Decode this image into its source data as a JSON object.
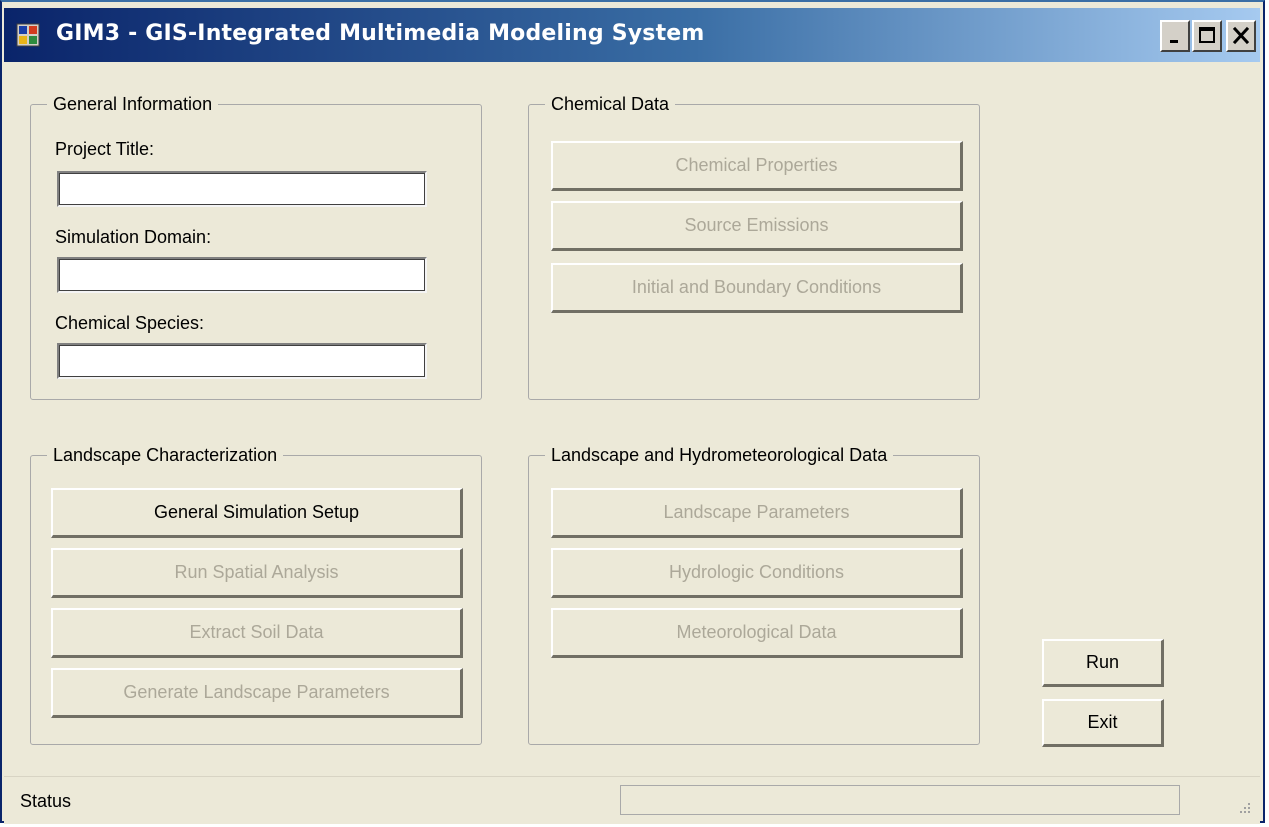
{
  "window": {
    "title": "GIM3 - GIS-Integrated Multimedia Modeling System",
    "app_icon": "app-window-icon",
    "controls": [
      "minimize-icon",
      "maximize-icon",
      "close-icon"
    ],
    "accent_color": "#0a246a"
  },
  "general_information": {
    "title": "General Information",
    "project_title_label": "Project Title:",
    "project_title_value": "",
    "simulation_domain_label": "Simulation Domain:",
    "simulation_domain_value": "",
    "chemical_species_label": "Chemical Species:",
    "chemical_species_value": ""
  },
  "chemical_data": {
    "title": "Chemical Data",
    "buttons": {
      "chemical_properties": "Chemical Properties",
      "source_emissions": "Source Emissions",
      "initial_boundary": "Initial and Boundary Conditions"
    }
  },
  "landscape_characterization": {
    "title": "Landscape Characterization",
    "buttons": {
      "general_setup": "General Simulation Setup",
      "spatial_analysis": "Run Spatial Analysis",
      "extract_soil": "Extract Soil Data",
      "generate_params": "Generate Landscape Parameters"
    }
  },
  "hydro_data": {
    "title": "Landscape and Hydrometeorological Data",
    "buttons": {
      "landscape_params": "Landscape Parameters",
      "hydrologic": "Hydrologic Conditions",
      "meteorological": "Meteorological Data"
    }
  },
  "actions": {
    "run": "Run",
    "exit": "Exit"
  },
  "statusbar": {
    "status": "Status",
    "progress": 0
  }
}
